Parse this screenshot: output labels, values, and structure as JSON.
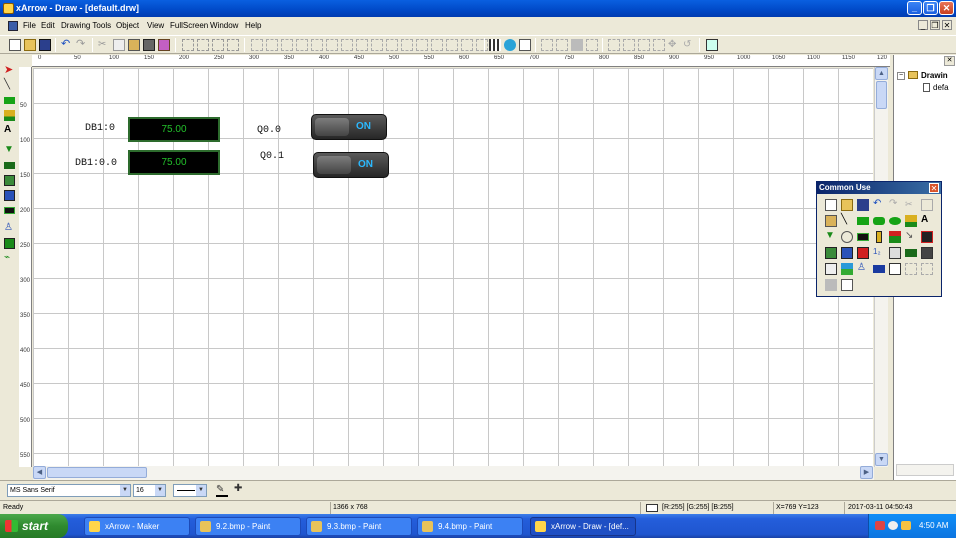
{
  "window": {
    "title": "xArrow - Draw - [default.drw]"
  },
  "menu": [
    "File",
    "Edit",
    "Drawing Tools",
    "Object",
    "View",
    "FullScreen",
    "Window",
    "Help"
  ],
  "ruler": {
    "h": [
      "0",
      "50",
      "100",
      "150",
      "200",
      "250",
      "300",
      "350",
      "400",
      "450",
      "500",
      "550",
      "600",
      "650",
      "700",
      "750",
      "800",
      "850",
      "900",
      "950",
      "1000",
      "1050",
      "1100",
      "1150",
      "120"
    ],
    "v": [
      "50",
      "100",
      "150",
      "200",
      "250",
      "300",
      "350",
      "400",
      "450",
      "500",
      "550"
    ]
  },
  "canvas": {
    "label1": "DB1:0",
    "label2": "DB1:0.0",
    "display1": "75.00",
    "display2": "75.00",
    "label3": "Q0.0",
    "label4": "Q0.1",
    "toggle1": "ON",
    "toggle2": "ON"
  },
  "tree": {
    "root": "Drawin",
    "child": "defa"
  },
  "palette": {
    "title": "Common Use"
  },
  "fontbar": {
    "font": "MS Sans Serif",
    "size": "16"
  },
  "status": {
    "ready": "Ready",
    "resolution": "1366 x 768",
    "color": "[R:255] [G:255] [B:255]",
    "coords": "X=769 Y=123",
    "datetime": "2017-03-11  04:50:43"
  },
  "taskbar": {
    "start": "start",
    "items": [
      "xArrow - Maker",
      "9.2.bmp - Paint",
      "9.3.bmp - Paint",
      "9.4.bmp - Paint",
      "xArrow - Draw - [def..."
    ],
    "clock": "4:50 AM"
  },
  "colors": {
    "display_text": "#22c02a",
    "toggle_text": "#2bb9ff",
    "titlebar": "#0049c7"
  }
}
